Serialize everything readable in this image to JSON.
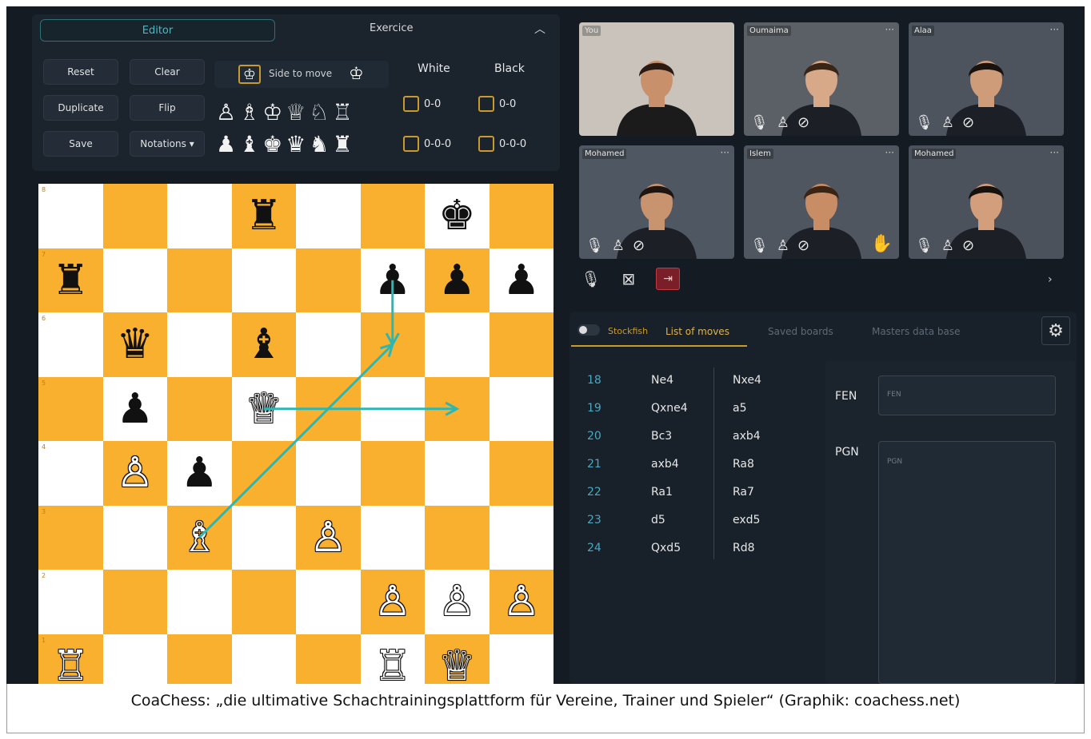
{
  "editor": {
    "tab_editor": "Editor",
    "tab_exercise": "Exercice",
    "buttons": {
      "reset": "Reset",
      "clear": "Clear",
      "duplicate": "Duplicate",
      "flip": "Flip",
      "save": "Save",
      "notations": "Notations ▾"
    },
    "side_to_move": "Side to move",
    "white_pieces": "♙♗♔♕♘♖",
    "black_pieces": "♟♝♚♛♞♜",
    "castling": {
      "white_header": "White",
      "black_header": "Black",
      "short": "0-0",
      "long": "0-0-0"
    }
  },
  "board": {
    "ranks": [
      "8",
      "7",
      "6",
      "5",
      "4",
      "3",
      "2",
      "1"
    ],
    "pieces": [
      {
        "sq": "d8",
        "glyph": "♜",
        "color": "b"
      },
      {
        "sq": "g8",
        "glyph": "♚",
        "color": "b"
      },
      {
        "sq": "a7",
        "glyph": "♜",
        "color": "b"
      },
      {
        "sq": "f7",
        "glyph": "♟",
        "color": "b"
      },
      {
        "sq": "g7",
        "glyph": "♟",
        "color": "b"
      },
      {
        "sq": "h7",
        "glyph": "♟",
        "color": "b"
      },
      {
        "sq": "b6",
        "glyph": "♛",
        "color": "b"
      },
      {
        "sq": "d6",
        "glyph": "♝",
        "color": "b"
      },
      {
        "sq": "b5",
        "glyph": "♟",
        "color": "b"
      },
      {
        "sq": "d5",
        "glyph": "♕",
        "color": "w"
      },
      {
        "sq": "b4",
        "glyph": "♙",
        "color": "w"
      },
      {
        "sq": "c4",
        "glyph": "♟",
        "color": "b"
      },
      {
        "sq": "c3",
        "glyph": "♗",
        "color": "w"
      },
      {
        "sq": "e3",
        "glyph": "♙",
        "color": "w"
      },
      {
        "sq": "f2",
        "glyph": "♙",
        "color": "w"
      },
      {
        "sq": "g2",
        "glyph": "♙",
        "color": "w"
      },
      {
        "sq": "h2",
        "glyph": "♙",
        "color": "w"
      },
      {
        "sq": "a1",
        "glyph": "♖",
        "color": "w"
      },
      {
        "sq": "f1",
        "glyph": "♖",
        "color": "w"
      },
      {
        "sq": "g1",
        "glyph": "♕",
        "color": "w"
      }
    ],
    "arrows": [
      {
        "from": "c3",
        "to": "f6"
      },
      {
        "from": "d5",
        "to": "g5"
      },
      {
        "from": "f7",
        "to": "f6"
      }
    ],
    "colors": {
      "light": "#ffffff",
      "dark": "#f9b02f",
      "arrow": "#2bb7b3"
    }
  },
  "participants": [
    {
      "name": "You",
      "bg": "#c9c3bb",
      "skin": "#c8916c",
      "hair": "#2a1a12",
      "shirt": "#1b1b1b"
    },
    {
      "name": "Oumaima",
      "bg": "#5b5f66",
      "skin": "#d8a989",
      "hair": "#3a2416",
      "shirt": "#1c1f26"
    },
    {
      "name": "Alaa",
      "bg": "#4d545e",
      "skin": "#cf9c7a",
      "hair": "#1a120c",
      "shirt": "#1c1f26"
    },
    {
      "name": "Mohamed",
      "bg": "#4f5762",
      "skin": "#c8946f",
      "hair": "#1e1510",
      "shirt": "#1c1f26"
    },
    {
      "name": "Islem",
      "bg": "#4f5660",
      "skin": "#c98d66",
      "hair": "#3c2415",
      "shirt": "#1c1f26"
    },
    {
      "name": "Mohamed",
      "bg": "#4b525c",
      "skin": "#d39e7b",
      "hair": "#17110c",
      "shirt": "#1c1f26"
    }
  ],
  "icons": {
    "more": "···",
    "mic": "🎙",
    "pawn": "♙",
    "block": "⊘",
    "hand": "✋",
    "video_off": "⊠",
    "leave": "⇥",
    "chevron": "›",
    "gear": "⚙"
  },
  "tabs": {
    "stockfish": "Stockfish",
    "moves": "List of moves",
    "saved": "Saved boards",
    "masters": "Masters data base"
  },
  "moves": [
    {
      "n": "18",
      "w": "Ne4",
      "b": "Nxe4"
    },
    {
      "n": "19",
      "w": "Qxne4",
      "b": "a5"
    },
    {
      "n": "20",
      "w": "Bc3",
      "b": "axb4"
    },
    {
      "n": "21",
      "w": "axb4",
      "b": "Ra8"
    },
    {
      "n": "22",
      "w": "Ra1",
      "b": "Ra7"
    },
    {
      "n": "23",
      "w": "d5",
      "b": "exd5"
    },
    {
      "n": "24",
      "w": "Qxd5",
      "b": "Rd8"
    }
  ],
  "fen": {
    "label": "FEN",
    "placeholder": "FEN"
  },
  "pgn": {
    "label": "PGN",
    "placeholder": "PGN"
  },
  "caption": "CoaChess: „die ultimative Schachtrainingsplattform für Vereine, Trainer und Spieler“ (Graphik: coachess.net)"
}
